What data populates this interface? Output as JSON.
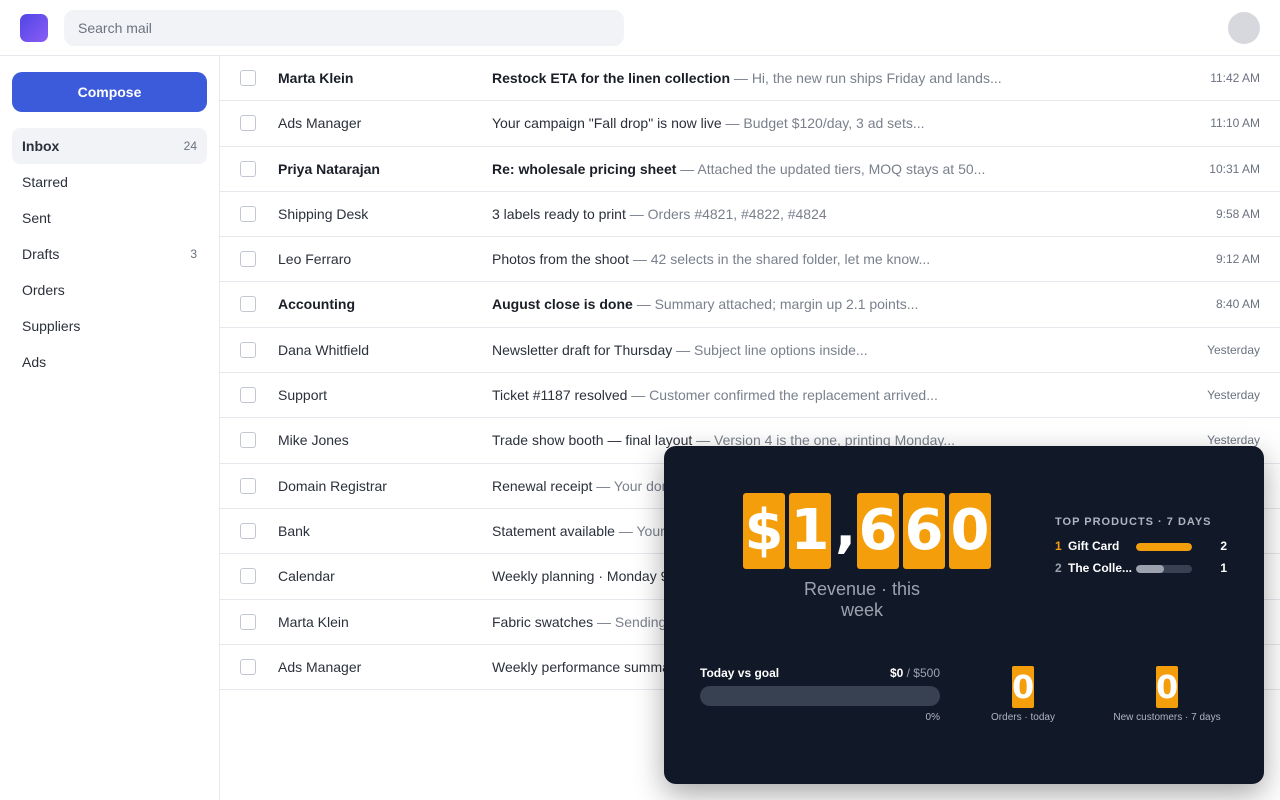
{
  "search": {
    "placeholder": "Search mail"
  },
  "sidebar": {
    "compose_label": "Compose",
    "items": [
      {
        "label": "Inbox",
        "count": "24"
      },
      {
        "label": "Starred",
        "count": ""
      },
      {
        "label": "Sent",
        "count": ""
      },
      {
        "label": "Drafts",
        "count": "3"
      },
      {
        "label": "Orders",
        "count": ""
      },
      {
        "label": "Suppliers",
        "count": ""
      },
      {
        "label": "Ads",
        "count": ""
      }
    ]
  },
  "emails": [
    {
      "sender": "Marta Klein",
      "subject": "Restock ETA for the linen collection",
      "snippet": " — Hi, the new run ships Friday and lands...",
      "time": "11:42 AM",
      "unread": true
    },
    {
      "sender": "Ads Manager",
      "subject": "Your campaign \"Fall drop\" is now live",
      "snippet": " — Budget $120/day, 3 ad sets...",
      "time": "11:10 AM",
      "unread": false
    },
    {
      "sender": "Priya Natarajan",
      "subject": "Re: wholesale pricing sheet",
      "snippet": " — Attached the updated tiers, MOQ stays at 50...",
      "time": "10:31 AM",
      "unread": true
    },
    {
      "sender": "Shipping Desk",
      "subject": "3 labels ready to print",
      "snippet": " — Orders #4821, #4822, #4824",
      "time": "9:58 AM",
      "unread": false
    },
    {
      "sender": "Leo Ferraro",
      "subject": "Photos from the shoot",
      "snippet": " — 42 selects in the shared folder, let me know...",
      "time": "9:12 AM",
      "unread": false
    },
    {
      "sender": "Accounting",
      "subject": "August close is done",
      "snippet": " — Summary attached; margin up 2.1 points...",
      "time": "8:40 AM",
      "unread": true
    },
    {
      "sender": "Dana Whitfield",
      "subject": "Newsletter draft for Thursday",
      "snippet": " — Subject line options inside...",
      "time": "Yesterday",
      "unread": false
    },
    {
      "sender": "Support",
      "subject": "Ticket #1187 resolved",
      "snippet": " — Customer confirmed the replacement arrived...",
      "time": "Yesterday",
      "unread": false
    },
    {
      "sender": "Mike Jones",
      "subject": "Trade show booth — final layout",
      "snippet": " — Version 4 is the one, printing Monday...",
      "time": "Yesterday",
      "unread": false
    },
    {
      "sender": "Domain Registrar",
      "subject": "Renewal receipt",
      "snippet": " — Your dom",
      "time": "",
      "unread": false
    },
    {
      "sender": "Bank",
      "subject": "Statement available",
      "snippet": " — Your",
      "time": "",
      "unread": false
    },
    {
      "sender": "Calendar",
      "subject": "Weekly planning · Monday 9",
      "snippet": "",
      "time": "",
      "unread": false
    },
    {
      "sender": "Marta Klein",
      "subject": "Fabric swatches",
      "snippet": " — Sending",
      "time": "",
      "unread": false
    },
    {
      "sender": "Ads Manager",
      "subject": "Weekly performance summa",
      "snippet": "",
      "time": "",
      "unread": false
    }
  ],
  "widget": {
    "revenue_chars": [
      "$",
      "1",
      ",",
      "6",
      "6",
      "0"
    ],
    "revenue_caption": "Revenue · this week",
    "top_products": {
      "title": "TOP PRODUCTS · 7 DAYS",
      "items": [
        {
          "rank": "1",
          "name": "Gift Card",
          "count": "2",
          "share": 1.0,
          "color": "#f59e0b"
        },
        {
          "rank": "2",
          "name": "The Colle...",
          "count": "1",
          "share": 0.5,
          "color": "#9ca3af"
        }
      ]
    },
    "goal": {
      "label": "Today vs goal",
      "current": "$0",
      "target": " / $500",
      "fraction": 0,
      "percent": "0%"
    },
    "orders_today": {
      "value": "0",
      "label": "Orders · today"
    },
    "new_customers": {
      "value": "0",
      "label": "New customers · 7 days"
    },
    "accent": "#f59e0b"
  }
}
